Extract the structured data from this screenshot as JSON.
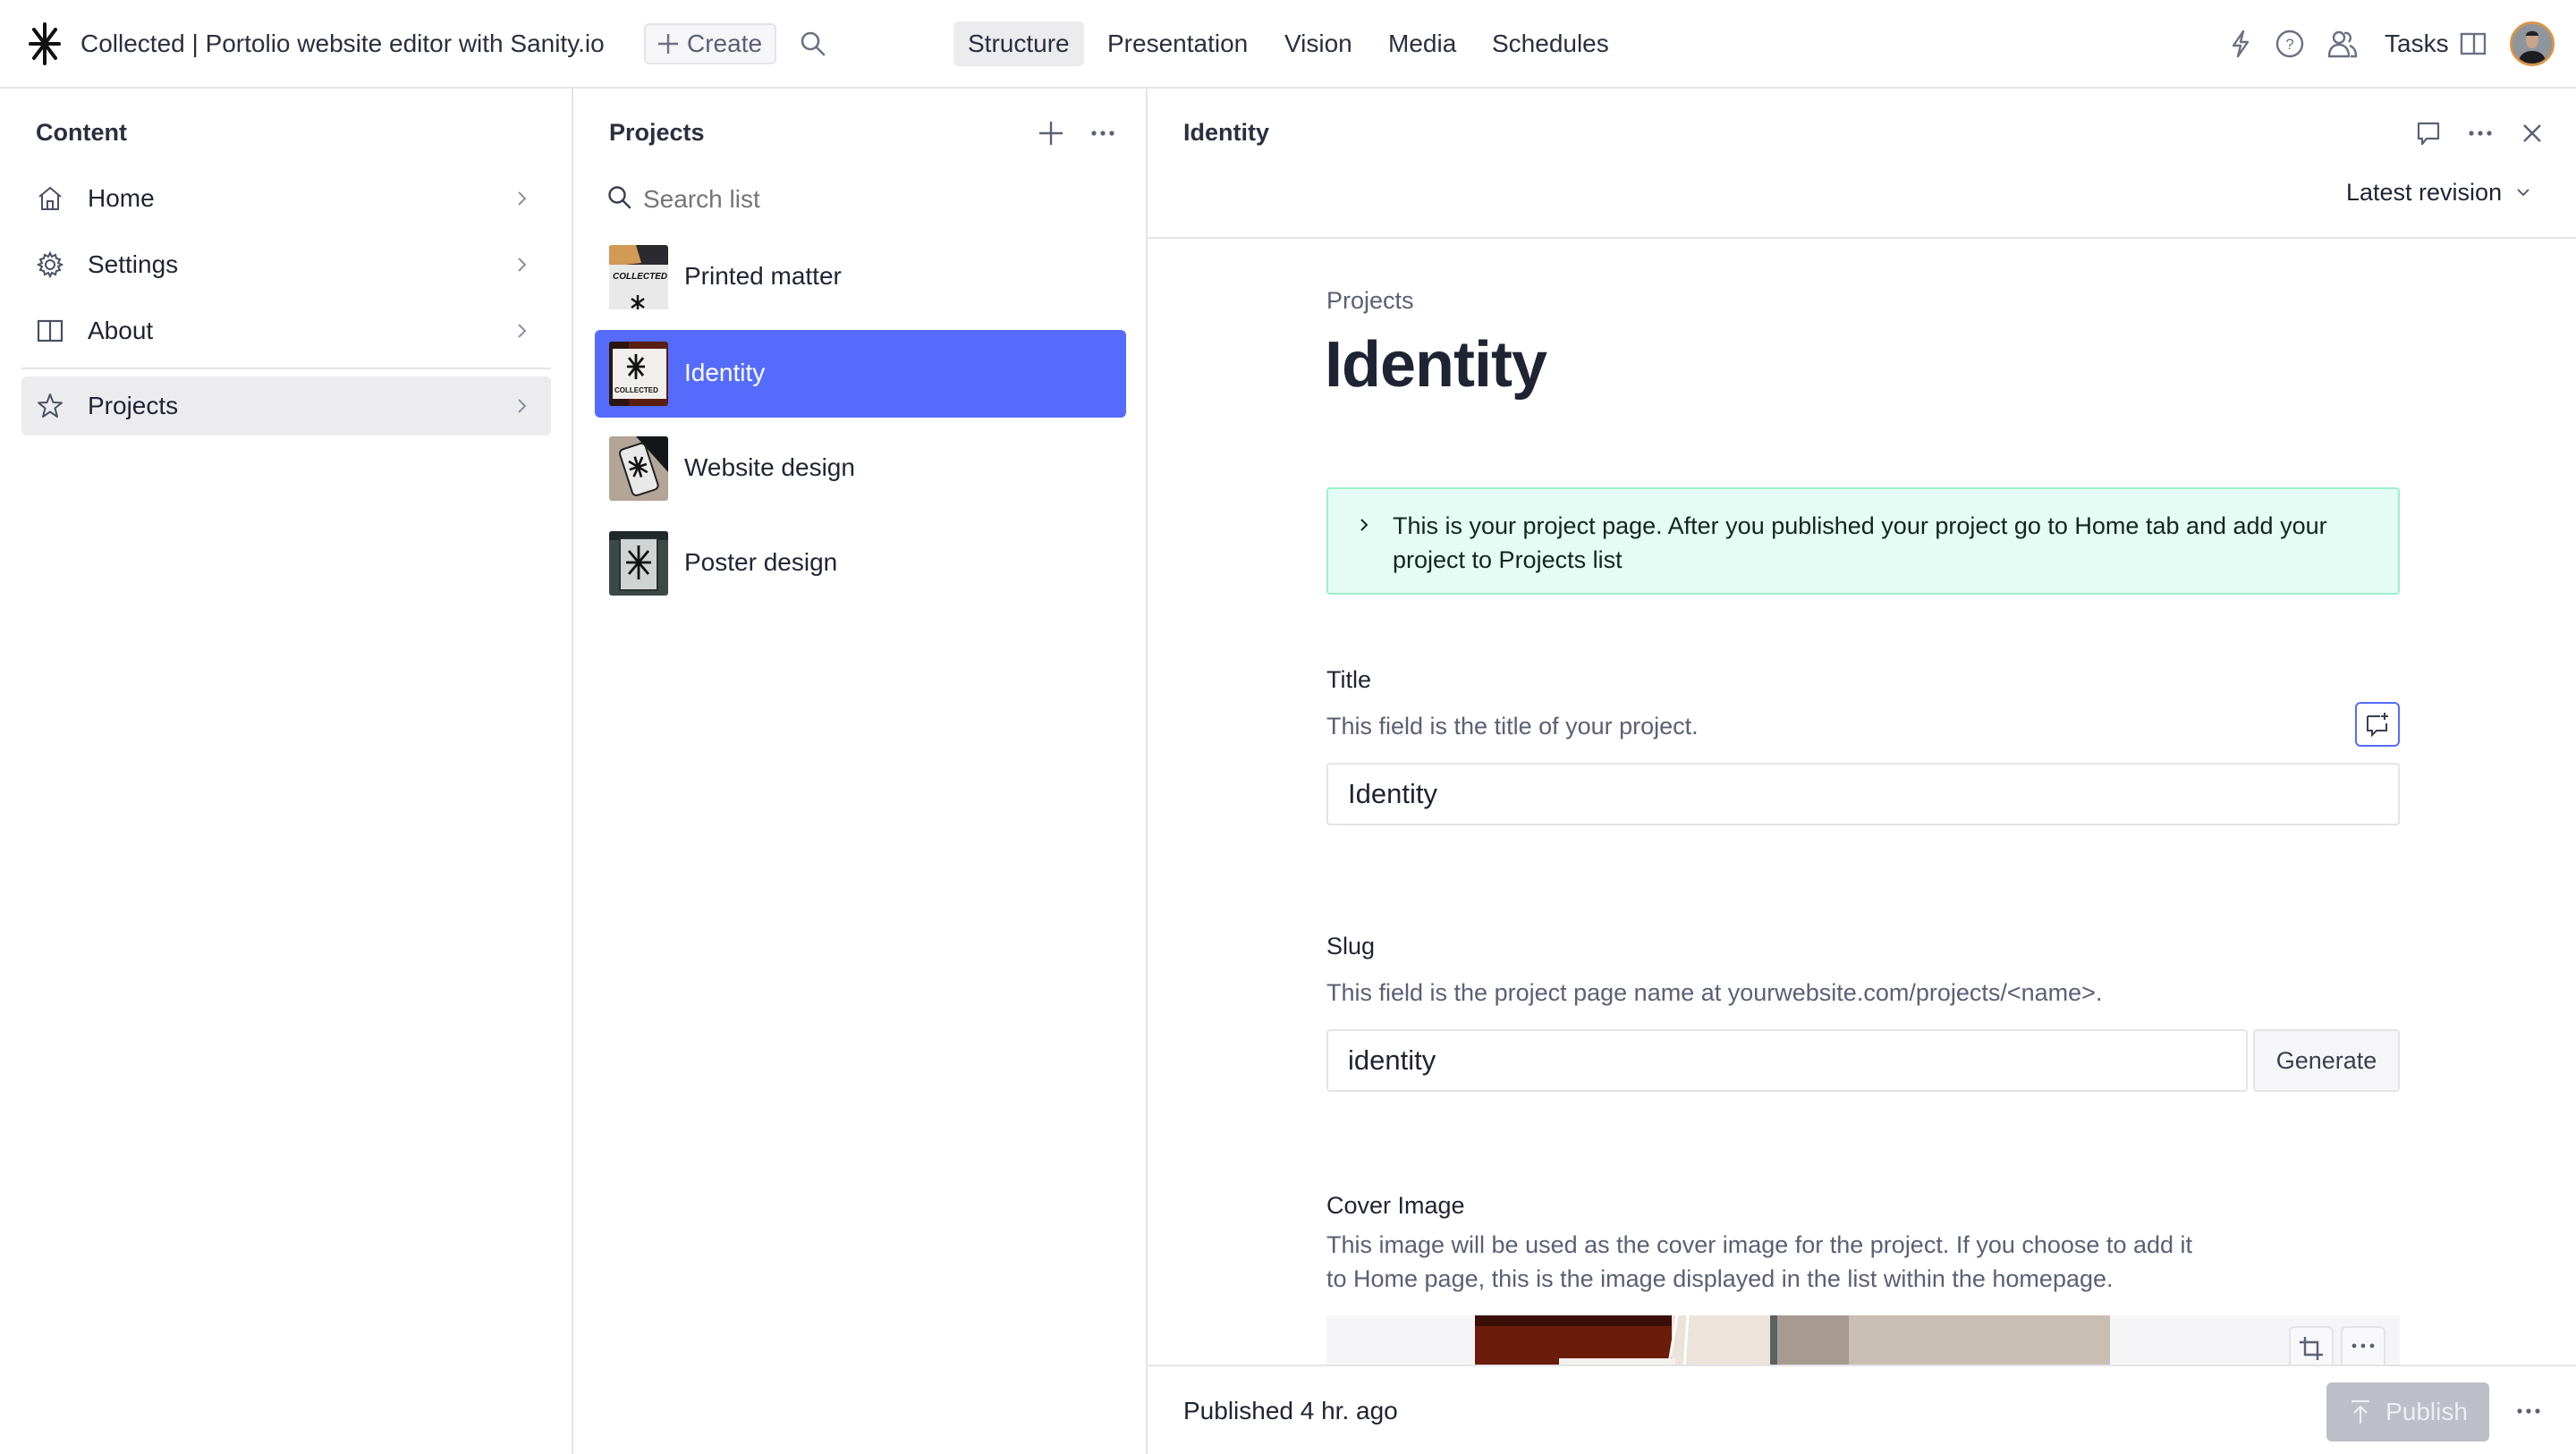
{
  "topbar": {
    "app_title": "Collected | Portolio website editor with Sanity.io",
    "create_label": "Create",
    "nav": [
      {
        "label": "Structure",
        "active": true
      },
      {
        "label": "Presentation",
        "active": false
      },
      {
        "label": "Vision",
        "active": false
      },
      {
        "label": "Media",
        "active": false
      },
      {
        "label": "Schedules",
        "active": false
      }
    ],
    "tasks_label": "Tasks",
    "icons": [
      "asterisk-logo-icon",
      "plus-icon",
      "search-icon",
      "bolt-icon",
      "help-circle-icon",
      "users-icon",
      "panel-split-icon",
      "avatar"
    ]
  },
  "sidebar": {
    "title": "Content",
    "items": [
      {
        "label": "Home",
        "icon": "home-icon",
        "active": false
      },
      {
        "label": "Settings",
        "icon": "gear-icon",
        "active": false
      },
      {
        "label": "About",
        "icon": "book-icon",
        "active": false
      },
      {
        "label": "Projects",
        "icon": "star-icon",
        "active": true
      }
    ]
  },
  "list": {
    "title": "Projects",
    "search_placeholder": "Search list",
    "items": [
      {
        "label": "Printed matter",
        "active": false
      },
      {
        "label": "Identity",
        "active": true
      },
      {
        "label": "Website design",
        "active": false
      },
      {
        "label": "Poster design",
        "active": false
      }
    ]
  },
  "document": {
    "header_title": "Identity",
    "revision_label": "Latest revision",
    "breadcrumb": "Projects",
    "title": "Identity",
    "callout": "This is your project page. After you published your project go to Home tab and add your project to Projects list",
    "fields": {
      "title": {
        "label": "Title",
        "description": "This field is the title of your project.",
        "value": "Identity"
      },
      "slug": {
        "label": "Slug",
        "description": "This field is the project page name at yourwebsite.com/projects/<name>.",
        "value": "identity",
        "generate_label": "Generate"
      },
      "cover_image": {
        "label": "Cover Image",
        "description_line1": "This image will be used as the cover image for the project. If you choose to add it",
        "description_line2": "to Home page, this is the image displayed in the list within the homepage."
      }
    },
    "footer": {
      "status": "Published 4 hr. ago",
      "publish_label": "Publish"
    }
  },
  "colors": {
    "accent": "#556bfc",
    "callout_bg": "#e4fcf3",
    "callout_border": "#9cf0cc",
    "avatar_ring": "#d8954a",
    "publish_disabled": "#bcbec8"
  }
}
